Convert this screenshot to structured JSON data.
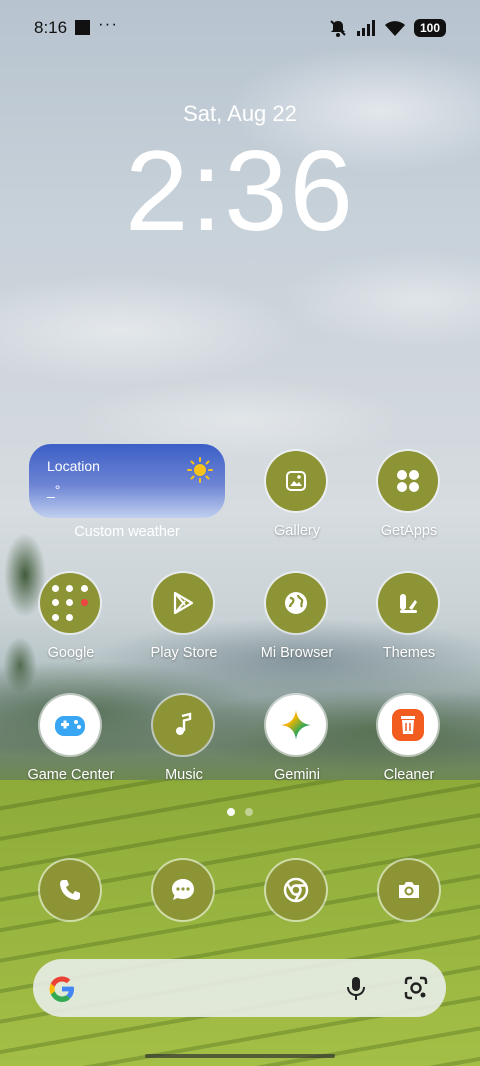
{
  "status_bar": {
    "time": "8:16",
    "overflow": "···",
    "battery": "100",
    "icons": [
      "mute-icon",
      "signal-icon",
      "wifi-icon",
      "battery-icon"
    ]
  },
  "lockclock": {
    "date": "Sat, Aug 22",
    "time": "2:36"
  },
  "weather_widget": {
    "location": "Location",
    "temp": "_°",
    "label": "Custom weather",
    "icon": "sun-icon"
  },
  "apps": [
    {
      "label": "Gallery",
      "icon": "gallery-icon"
    },
    {
      "label": "GetApps",
      "icon": "getapps-icon"
    },
    {
      "label": "Google",
      "icon": "folder-icon"
    },
    {
      "label": "Play Store",
      "icon": "play-store-icon"
    },
    {
      "label": "Mi Browser",
      "icon": "globe-icon"
    },
    {
      "label": "Themes",
      "icon": "themes-icon"
    },
    {
      "label": "Game Center",
      "icon": "gamepad-icon"
    },
    {
      "label": "Music",
      "icon": "music-note-icon"
    },
    {
      "label": "Gemini",
      "icon": "gemini-icon"
    },
    {
      "label": "Cleaner",
      "icon": "trash-icon"
    }
  ],
  "dock": [
    "phone-icon",
    "messages-icon",
    "chrome-icon",
    "camera-icon"
  ],
  "page_indicator": {
    "current": 1,
    "total": 2
  },
  "search_bar": {
    "icons": [
      "google-g-icon",
      "microphone-icon",
      "google-lens-icon"
    ]
  },
  "colors": {
    "icon_bg": "#8d9435",
    "weather_top": "#3c5fc6",
    "weather_bottom": "#c0d0ef"
  }
}
